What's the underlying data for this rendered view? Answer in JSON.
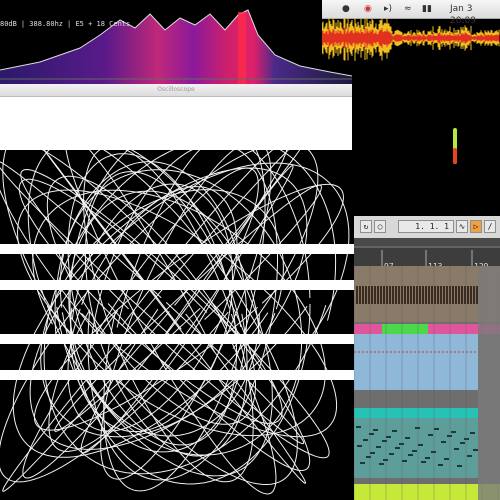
{
  "spectrum": {
    "readout": [
      "80dB",
      "388.80hz",
      "E5 + 18 Cents"
    ]
  },
  "menubar": {
    "clock": "Jan 3  20:09"
  },
  "scope": {
    "window_title": "Oscilloscope"
  },
  "daw": {
    "position": "1.  1.  1",
    "ruler_labels": [
      "97",
      "113",
      "129"
    ],
    "clip_colors": {
      "pink": "#e0569c",
      "green": "#4bd84b",
      "cyan": "#26c2b6",
      "lime": "#c6e838",
      "brown": "#8a7a68",
      "blue": "#8fb7d8",
      "teal": "#5d9e9a"
    }
  },
  "icons": [
    "apple-icon",
    "record-icon",
    "volume-icon",
    "wifi-icon",
    "battery-icon",
    "loop-icon",
    "metronome-icon",
    "draw-mode-icon",
    "follow-icon"
  ]
}
